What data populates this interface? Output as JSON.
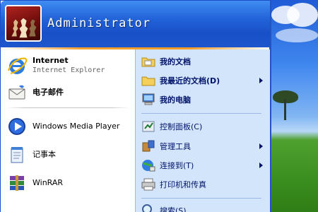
{
  "user": {
    "name": "Administrator"
  },
  "left": {
    "pinned": [
      {
        "title": "Internet",
        "subtitle": "Internet Explorer",
        "icon": "internet-explorer-icon"
      },
      {
        "title": "电子邮件",
        "icon": "email-icon"
      }
    ],
    "recent": [
      {
        "title": "Windows Media Player",
        "icon": "media-player-icon"
      },
      {
        "title": "记事本",
        "icon": "notepad-icon"
      },
      {
        "title": "WinRAR",
        "icon": "winrar-icon"
      }
    ]
  },
  "right": {
    "items": [
      {
        "label": "我的文档",
        "icon": "folder-icon",
        "bold": true,
        "submenu": false
      },
      {
        "label": "我最近的文档(D)",
        "icon": "recent-folder-icon",
        "bold": true,
        "submenu": true
      },
      {
        "label": "我的电脑",
        "icon": "computer-icon",
        "bold": true,
        "submenu": false
      },
      {
        "label": "控制面板(C)",
        "icon": "control-panel-icon",
        "bold": false,
        "submenu": false
      },
      {
        "label": "管理工具",
        "icon": "admin-tools-icon",
        "bold": false,
        "submenu": true
      },
      {
        "label": "连接到(T)",
        "icon": "connect-icon",
        "bold": false,
        "submenu": true
      },
      {
        "label": "打印机和传真",
        "icon": "printer-icon",
        "bold": false,
        "submenu": false
      },
      {
        "label": "搜索(S)",
        "icon": "search-icon",
        "bold": false,
        "submenu": false
      }
    ]
  },
  "colors": {
    "header": "#2262d8",
    "right_panel": "#d3e5fa",
    "accent_line": "#f39c26",
    "right_text": "#00136b"
  }
}
